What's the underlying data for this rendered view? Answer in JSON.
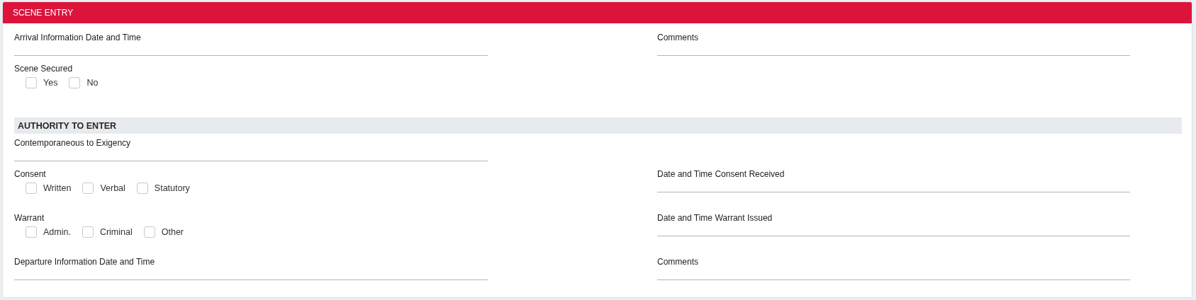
{
  "panel": {
    "title": "SCENE ENTRY"
  },
  "rows": [
    {
      "kind": "row",
      "left": {
        "kind": "field",
        "label": "Arrival Information Date and Time"
      },
      "right": {
        "kind": "field",
        "label": "Comments"
      }
    },
    {
      "kind": "row",
      "left": {
        "kind": "checkgroup",
        "label": "Scene Secured",
        "options": [
          {
            "label": "Yes",
            "checked": false
          },
          {
            "label": "No",
            "checked": false
          }
        ]
      }
    },
    {
      "kind": "heading",
      "label": "AUTHORITY TO ENTER"
    },
    {
      "kind": "row",
      "left": {
        "kind": "field",
        "label": "Contemporaneous to Exigency"
      }
    },
    {
      "kind": "row",
      "left": {
        "kind": "checkgroup",
        "label": "Consent",
        "options": [
          {
            "label": "Written",
            "checked": false
          },
          {
            "label": "Verbal",
            "checked": false
          },
          {
            "label": "Statutory",
            "checked": false
          }
        ]
      },
      "right": {
        "kind": "field",
        "label": "Date and Time Consent Received"
      }
    },
    {
      "kind": "row",
      "left": {
        "kind": "checkgroup",
        "label": "Warrant",
        "options": [
          {
            "label": "Admin.",
            "checked": false
          },
          {
            "label": "Criminal",
            "checked": false
          },
          {
            "label": "Other",
            "checked": false
          }
        ]
      },
      "right": {
        "kind": "field",
        "label": "Date and Time Warrant Issued"
      }
    },
    {
      "kind": "row",
      "left": {
        "kind": "field",
        "label": "Departure Information Date and Time"
      },
      "right": {
        "kind": "field",
        "label": "Comments"
      }
    }
  ]
}
